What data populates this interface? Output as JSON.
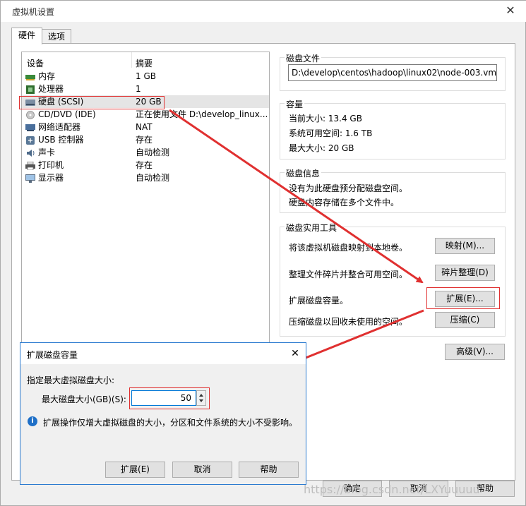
{
  "window": {
    "title": "虚拟机设置",
    "close_glyph": "✕"
  },
  "tabs": [
    {
      "label": "硬件"
    },
    {
      "label": "选项"
    }
  ],
  "device_list": {
    "headers": {
      "device": "设备",
      "summary": "摘要"
    },
    "rows": [
      {
        "name": "内存",
        "summary": "1 GB",
        "icon": "memory-icon"
      },
      {
        "name": "处理器",
        "summary": "1",
        "icon": "processor-icon"
      },
      {
        "name": "硬盘 (SCSI)",
        "summary": "20 GB",
        "icon": "hard-disk-icon"
      },
      {
        "name": "CD/DVD (IDE)",
        "summary": "正在使用文件 D:\\develop_linux...",
        "icon": "cd-dvd-icon"
      },
      {
        "name": "网络适配器",
        "summary": "NAT",
        "icon": "network-adapter-icon"
      },
      {
        "name": "USB 控制器",
        "summary": "存在",
        "icon": "usb-icon"
      },
      {
        "name": "声卡",
        "summary": "自动检测",
        "icon": "sound-card-icon"
      },
      {
        "name": "打印机",
        "summary": "存在",
        "icon": "printer-icon"
      },
      {
        "name": "显示器",
        "summary": "自动检测",
        "icon": "display-icon"
      }
    ]
  },
  "disk_file": {
    "title": "磁盘文件",
    "path": "D:\\develop\\centos\\hadoop\\linux02\\node-003.vmdk"
  },
  "capacity": {
    "title": "容量",
    "current": "当前大小: 13.4 GB",
    "available": "系统可用空间: 1.6 TB",
    "max": "最大大小: 20 GB"
  },
  "disk_info": {
    "title": "磁盘信息",
    "line1": "没有为此硬盘预分配磁盘空间。",
    "line2": "硬盘内容存储在多个文件中。"
  },
  "utilities": {
    "title": "磁盘实用工具",
    "map_desc": "将该虚拟机磁盘映射到本地卷。",
    "map_btn": "映射(M)...",
    "defrag_desc": "整理文件碎片并整合可用空间。",
    "defrag_btn": "碎片整理(D)",
    "expand_desc": "扩展磁盘容量。",
    "expand_btn": "扩展(E)...",
    "compact_desc": "压缩磁盘以回收未使用的空间。",
    "compact_btn": "压缩(C)"
  },
  "advanced_btn": "高级(V)...",
  "footer": {
    "ok": "确定",
    "cancel": "取消",
    "help": "帮助"
  },
  "dialog": {
    "title": "扩展磁盘容量",
    "close_glyph": "✕",
    "heading": "指定最大虚拟磁盘大小:",
    "field_label": "最大磁盘大小(GB)(S):",
    "value": "50",
    "info": "扩展操作仅增大虚拟磁盘的大小，分区和文件系统的大小不受影响。",
    "info_glyph": "i",
    "expand_btn": "扩展(E)",
    "cancel_btn": "取消",
    "help_btn": "帮助"
  },
  "watermark": "https://blog.csdn.net/LXYuuuuu",
  "colors": {
    "annotation_red": "#e03030",
    "focus_blue": "#0078d7"
  }
}
